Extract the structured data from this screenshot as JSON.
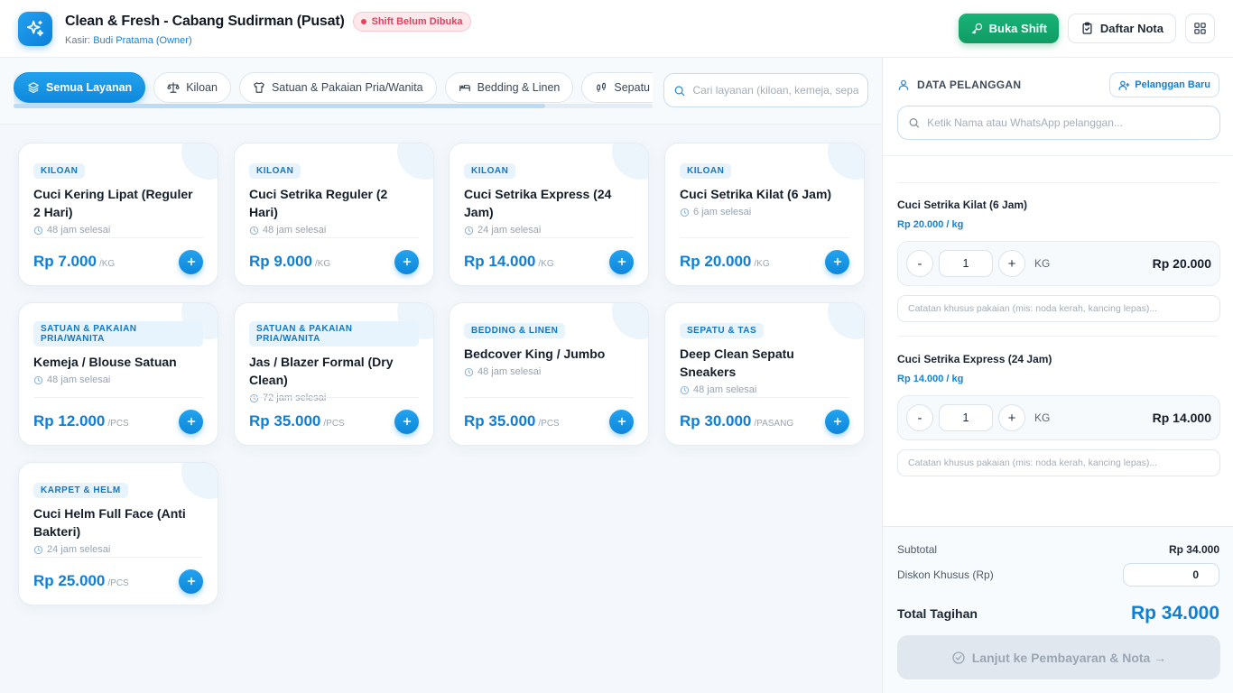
{
  "header": {
    "title": "Clean & Fresh - Cabang Sudirman (Pusat)",
    "shift_status": "Shift Belum Dibuka",
    "cashier_label": "Kasir:",
    "cashier_name": "Budi Pratama (Owner)",
    "open_shift_label": "Buka Shift",
    "receipts_label": "Daftar Nota"
  },
  "categories": {
    "tabs": [
      {
        "label": "Semua Layanan",
        "icon": "layers-icon",
        "active": true
      },
      {
        "label": "Kiloan",
        "icon": "scale-icon",
        "active": false
      },
      {
        "label": "Satuan & Pakaian Pria/Wanita",
        "icon": "shirt-icon",
        "active": false
      },
      {
        "label": "Bedding & Linen",
        "icon": "bed-icon",
        "active": false
      },
      {
        "label": "Sepatu & Tas",
        "icon": "footprints-icon",
        "active": false
      }
    ],
    "search_placeholder": "Cari layanan (kiloan, kemeja, sepatu...)"
  },
  "services": [
    {
      "category": "KILOAN",
      "name": "Cuci Kering Lipat (Reguler 2 Hari)",
      "duration": "48 jam selesai",
      "price": "Rp 7.000",
      "unit": "/KG"
    },
    {
      "category": "KILOAN",
      "name": "Cuci Setrika Reguler (2 Hari)",
      "duration": "48 jam selesai",
      "price": "Rp 9.000",
      "unit": "/KG"
    },
    {
      "category": "KILOAN",
      "name": "Cuci Setrika Express (24 Jam)",
      "duration": "24 jam selesai",
      "price": "Rp 14.000",
      "unit": "/KG"
    },
    {
      "category": "KILOAN",
      "name": "Cuci Setrika Kilat (6 Jam)",
      "duration": "6 jam selesai",
      "price": "Rp 20.000",
      "unit": "/KG"
    },
    {
      "category": "SATUAN & PAKAIAN PRIA/WANITA",
      "name": "Kemeja / Blouse Satuan",
      "duration": "48 jam selesai",
      "price": "Rp 12.000",
      "unit": "/PCS"
    },
    {
      "category": "SATUAN & PAKAIAN PRIA/WANITA",
      "name": "Jas / Blazer Formal (Dry Clean)",
      "duration": "72 jam selesai",
      "price": "Rp 35.000",
      "unit": "/PCS"
    },
    {
      "category": "BEDDING & LINEN",
      "name": "Bedcover King / Jumbo",
      "duration": "48 jam selesai",
      "price": "Rp 35.000",
      "unit": "/PCS"
    },
    {
      "category": "SEPATU & TAS",
      "name": "Deep Clean Sepatu Sneakers",
      "duration": "48 jam selesai",
      "price": "Rp 30.000",
      "unit": "/PASANG"
    },
    {
      "category": "KARPET & HELM",
      "name": "Cuci Helm Full Face (Anti Bakteri)",
      "duration": "24 jam selesai",
      "price": "Rp 25.000",
      "unit": "/PCS"
    }
  ],
  "customer": {
    "title": "DATA PELANGGAN",
    "new_button_label": "Pelanggan Baru",
    "search_placeholder": "Ketik Nama atau WhatsApp pelanggan..."
  },
  "cart": {
    "items": [
      {
        "name": "Cuci Setrika Kilat (6 Jam)",
        "rate": "Rp 20.000 / kg",
        "qty": "1",
        "unit": "KG",
        "total": "Rp 20.000",
        "minus": "-",
        "plus": "+",
        "note_placeholder": "Catatan khusus pakaian (mis: noda kerah, kancing lepas)..."
      },
      {
        "name": "Cuci Setrika Express (24 Jam)",
        "rate": "Rp 14.000 / kg",
        "qty": "1",
        "unit": "KG",
        "total": "Rp 14.000",
        "minus": "-",
        "plus": "+",
        "note_placeholder": "Catatan khusus pakaian (mis: noda kerah, kancing lepas)..."
      }
    ]
  },
  "summary": {
    "subtotal_label": "Subtotal",
    "subtotal_value": "Rp 34.000",
    "discount_label": "Diskon Khusus (Rp)",
    "discount_value": "0",
    "total_label": "Total Tagihan",
    "total_value": "Rp 34.000",
    "pay_button_label": "Lanjut ke Pembayaran & Nota →"
  },
  "colors": {
    "accent": "#0e7fd6",
    "success": "#13a86d",
    "danger": "#e0425e",
    "disabled": "#e1e7ee"
  }
}
